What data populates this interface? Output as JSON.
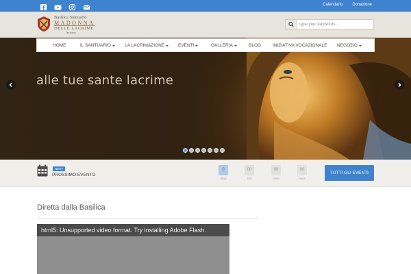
{
  "topbar": {
    "social_icons": [
      "facebook-icon",
      "youtube-icon",
      "instagram-icon",
      "email-icon"
    ],
    "links": [
      "Calendario",
      "Donazione"
    ]
  },
  "logo": {
    "line1": "Basilica Santuario",
    "line2": "MADONNA",
    "line3": "DELLE LACRIME",
    "line4": "Siracusa"
  },
  "search": {
    "placeholder": "Type your keywords..."
  },
  "nav": {
    "items": [
      {
        "label": "HOME",
        "dropdown": false
      },
      {
        "label": "IL SANTUARIO",
        "dropdown": true
      },
      {
        "label": "LA LACRIMAZIONE",
        "dropdown": true
      },
      {
        "label": "EVENTI",
        "dropdown": true
      },
      {
        "label": "GALLERIA",
        "dropdown": true
      },
      {
        "label": "BLOG",
        "dropdown": false
      },
      {
        "label": "INIZIATIVA VOCAZIONALE",
        "dropdown": false
      },
      {
        "label": "NEGOZIO",
        "dropdown": true
      }
    ]
  },
  "hero": {
    "caption": "alle tue sante lacrime",
    "slides": 7,
    "active_slide": 1
  },
  "event": {
    "badge": "NEXT",
    "label": "PROSSIMO EVENTO",
    "countdown": [
      {
        "value": "0",
        "unit": "days"
      },
      {
        "value": "00",
        "unit": "hrs"
      },
      {
        "value": "00",
        "unit": "mins"
      },
      {
        "value": "00",
        "unit": "secs"
      }
    ],
    "button_label": "TUTTI GLI EVENTI"
  },
  "content": {
    "section_title": "Diretta dalla Basilica",
    "video_message": "html5: Unsupported video format. Try installing Adobe Flash."
  },
  "colors": {
    "accent": "#3f83cf",
    "header_bg": "#e7e3dd",
    "strip_bg": "#f1efec"
  }
}
